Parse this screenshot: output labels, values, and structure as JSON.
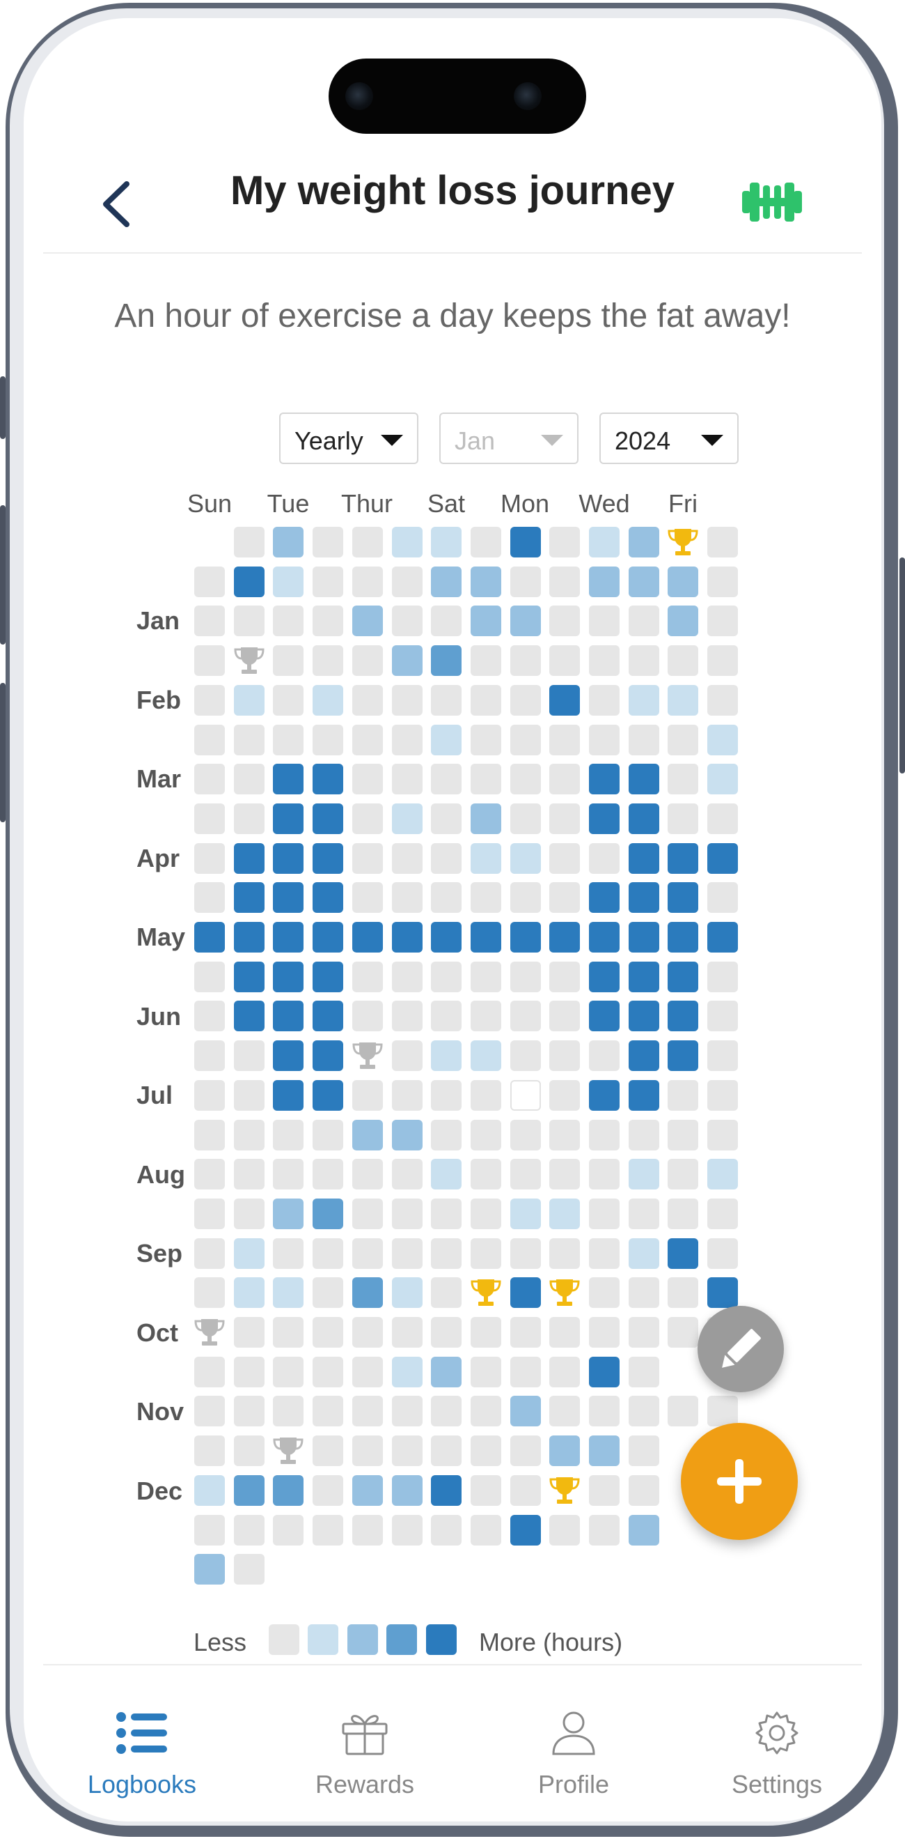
{
  "header": {
    "title": "My weight loss journey",
    "subtitle": "An hour of exercise a day keeps the fat away!"
  },
  "filters": {
    "period": "Yearly",
    "month": "Jan",
    "year": "2024"
  },
  "weekdays": [
    "Sun",
    "Tue",
    "Thur",
    "Sat",
    "Mon",
    "Wed",
    "Fri"
  ],
  "months": [
    "Jan",
    "Feb",
    "Mar",
    "Apr",
    "May",
    "Jun",
    "Jul",
    "Aug",
    "Sep",
    "Oct",
    "Nov",
    "Dec"
  ],
  "legend": {
    "less": "Less",
    "more": "More (hours)"
  },
  "colors": {
    "level0": "#e6e6e6",
    "level1": "#c9e0ef",
    "level2": "#97c1e1",
    "level3": "#5f9fd0",
    "level4": "#2b7bbd",
    "trophy_gold": "#f2b90f",
    "trophy_silver": "#b9b9b9",
    "accent": "#2b7bbd",
    "fab_add": "#f09e14",
    "fab_edit": "#9b9b9b",
    "header_icon": "#2ec26b"
  },
  "heatmap": {
    "note": "Each string is one row of 14 days; digits 0-4 = intensity level, G = gold trophy, S = silver trophy, B = empty outlined cell, '.' = no day.",
    "rows": [
      ".02001104012G00",
      "04100022002220",
      "00002002200020",
      "0S0002300000000",
      "01010000040110",
      "00000010000001",
      "00440000004401",
      "00440102004400",
      "04440001100444",
      "04440000004440",
      "44444444444444",
      "04440000004440",
      "04440000004440",
      "0044S0110004400",
      "00440000B04400",
      "00002200000000",
      "00000010000101",
      "00230000110000",
      "01000000000140",
      "0110310G4G0004",
      "S0000000000000",
      "000001200040",
      "00000000200000",
      "00S000000220",
      "133022400G00",
      "000000004002",
      "20"
    ]
  },
  "fabs": {
    "edit_icon": "pencil-icon",
    "add_icon": "plus-icon"
  },
  "tabbar": {
    "items": [
      {
        "label": "Logbooks",
        "icon": "list-icon",
        "active": true
      },
      {
        "label": "Rewards",
        "icon": "gift-icon",
        "active": false
      },
      {
        "label": "Profile",
        "icon": "person-icon",
        "active": false
      },
      {
        "label": "Settings",
        "icon": "gear-icon",
        "active": false
      }
    ]
  }
}
